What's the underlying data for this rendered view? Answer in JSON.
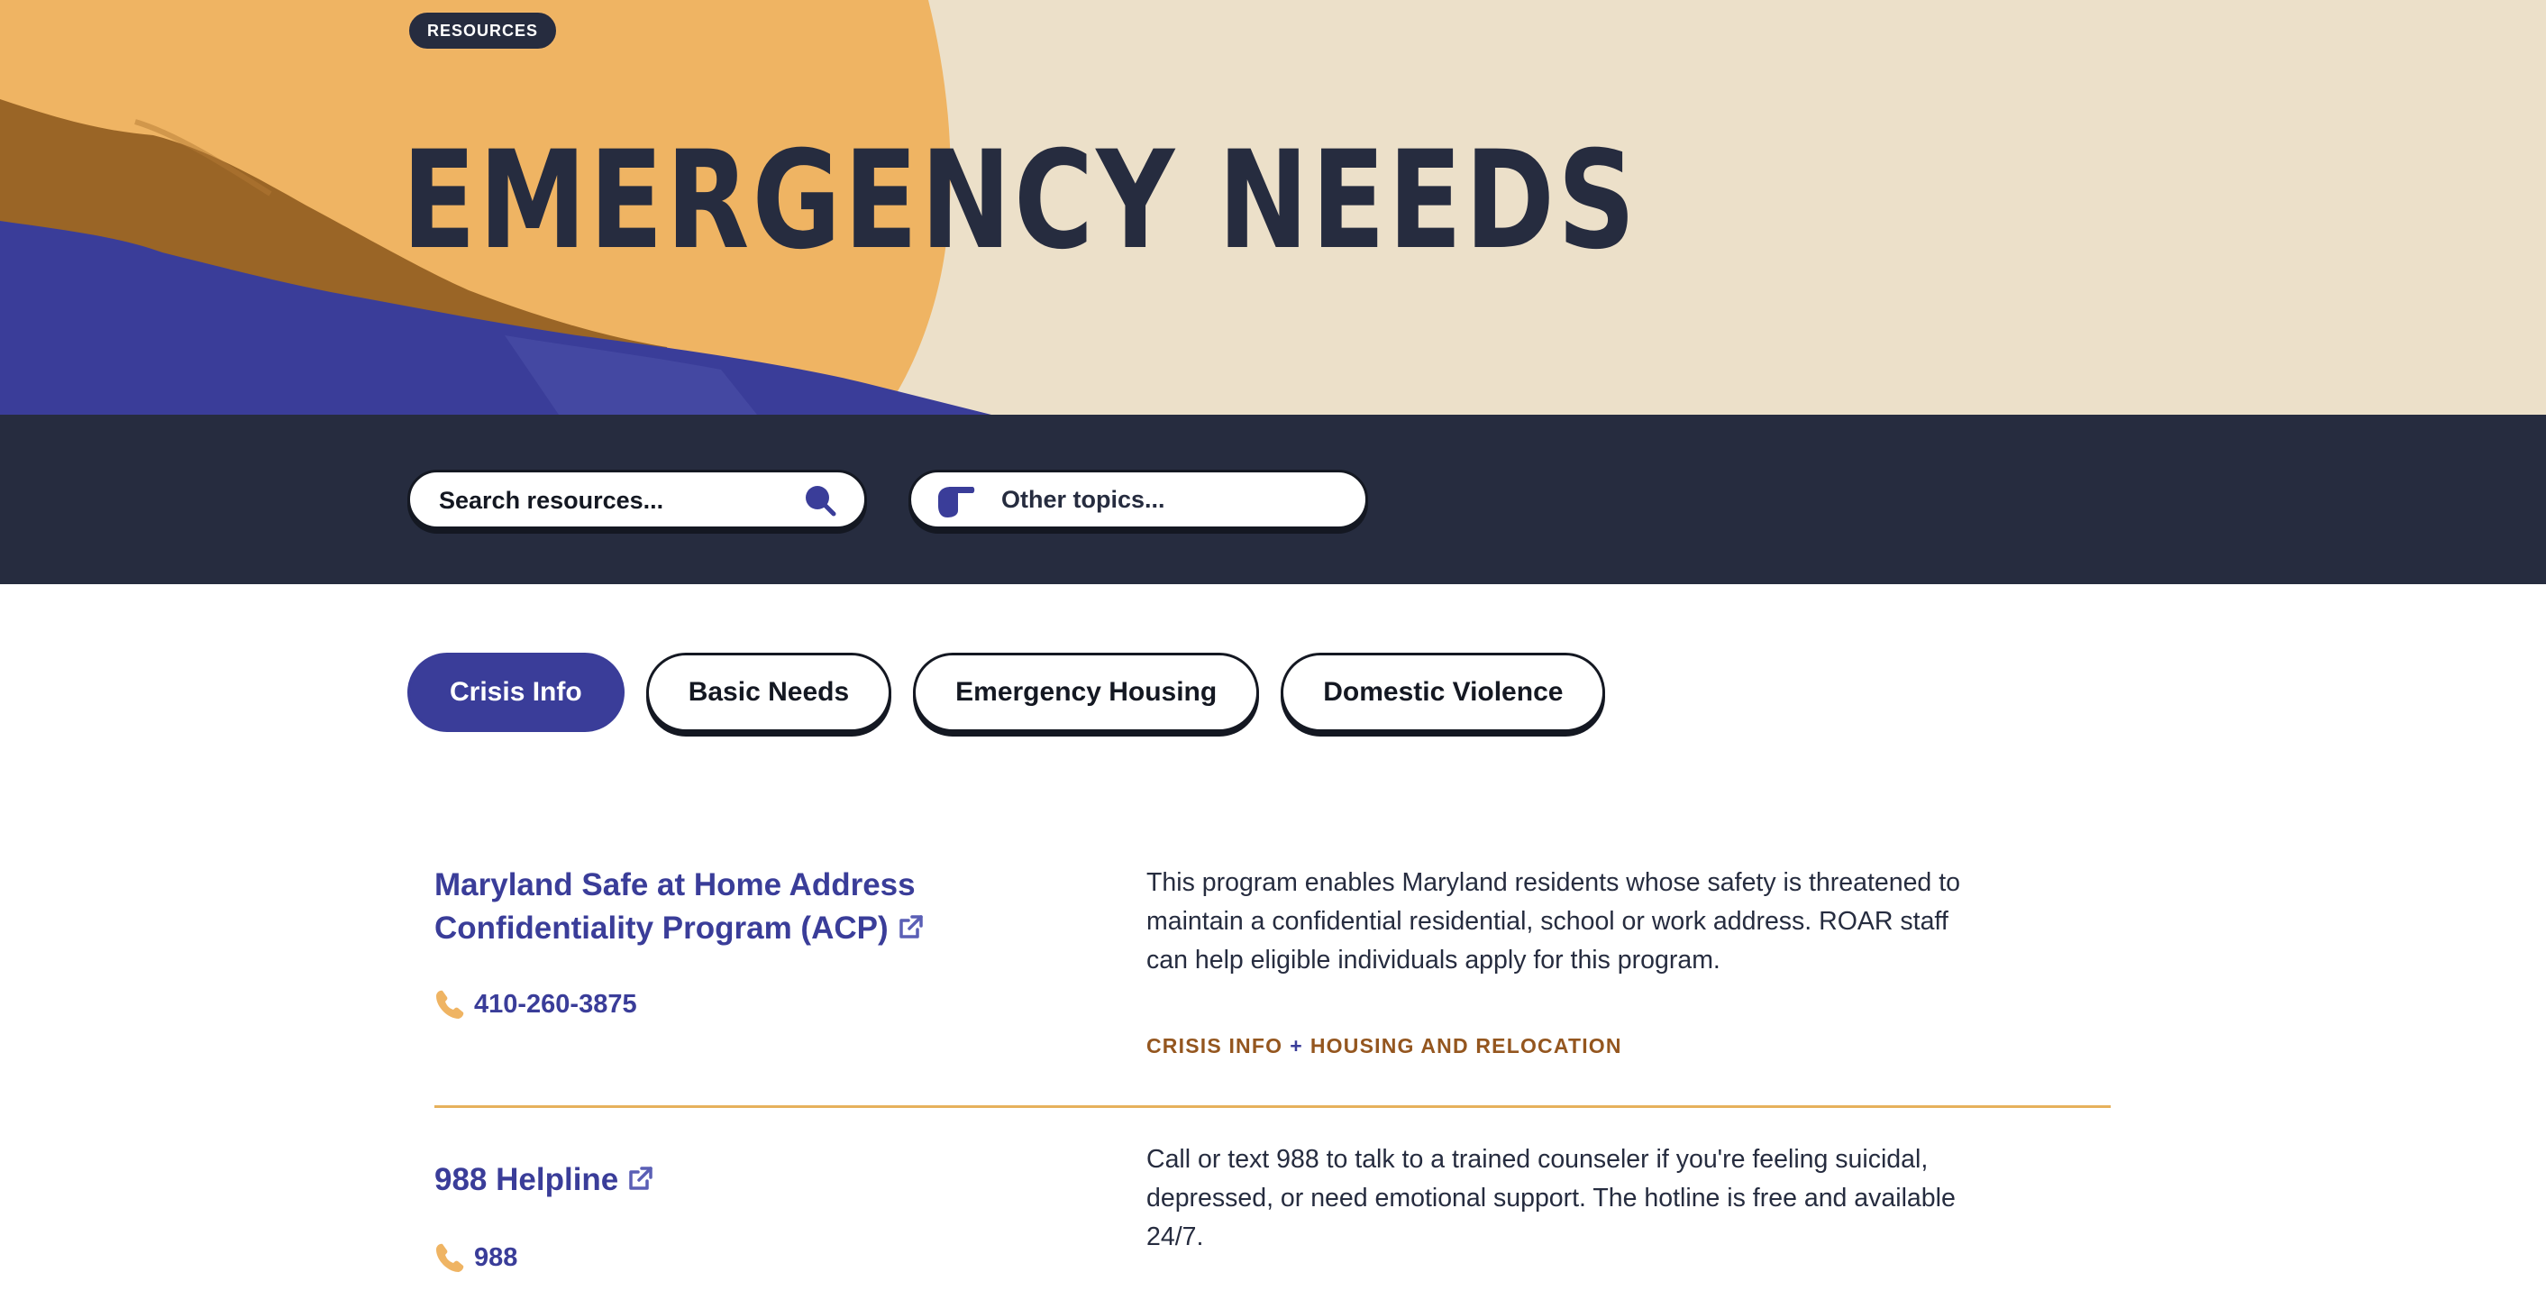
{
  "hero": {
    "badge": "RESOURCES",
    "title": "EMERGENCY NEEDS"
  },
  "search": {
    "placeholder": "Search resources...",
    "icon": "search-icon"
  },
  "topics": {
    "label": "Other topics...",
    "icon": "pointing-hand-icon"
  },
  "tabs": [
    {
      "label": "Crisis Info",
      "active": true
    },
    {
      "label": "Basic Needs",
      "active": false
    },
    {
      "label": "Emergency Housing",
      "active": false
    },
    {
      "label": "Domestic Violence",
      "active": false
    }
  ],
  "resources": [
    {
      "title": "Maryland Safe at Home Address Confidentiality Program (ACP)",
      "phone": "410-260-3875",
      "description": "This program enables Maryland residents whose safety is threatened to maintain a confidential residential, school or work address. ROAR staff can help eligible individuals apply for this program.",
      "tags": [
        "CRISIS INFO",
        "HOUSING AND RELOCATION"
      ]
    },
    {
      "title": "988 Helpline",
      "phone": "988",
      "description": "Call or text 988 to talk to a trained counseler if you're feeling suicidal, depressed, or need emotional support. The hotline is free and available 24/7."
    }
  ],
  "colors": {
    "navy": "#262c3f",
    "accent_blue": "#3a3d99",
    "hero_cream": "#ece0c9",
    "hero_orange": "#efb463",
    "hero_brown": "#9a6526",
    "tag_brown": "#94561f",
    "divider_gold": "#e6b15c"
  }
}
